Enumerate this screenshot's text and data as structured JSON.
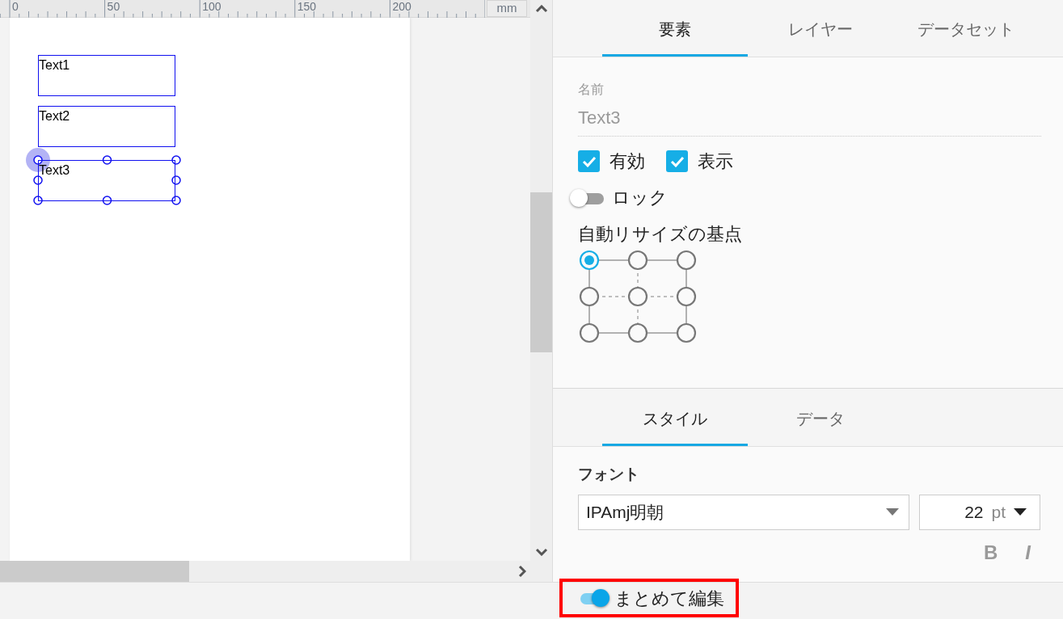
{
  "ruler": {
    "labels": [
      "0",
      "50",
      "100",
      "150",
      "200"
    ],
    "unit": "mm"
  },
  "canvas": {
    "elements": [
      {
        "label": "Text1",
        "selected": false
      },
      {
        "label": "Text2",
        "selected": false
      },
      {
        "label": "Text3",
        "selected": true
      }
    ]
  },
  "tabs": [
    {
      "label": "要素",
      "selected": true
    },
    {
      "label": "レイヤー",
      "selected": false
    },
    {
      "label": "データセット",
      "selected": false
    }
  ],
  "element": {
    "name_label": "名前",
    "name_value": "Text3",
    "checkboxes": [
      {
        "label": "有効",
        "checked": true
      },
      {
        "label": "表示",
        "checked": true
      }
    ],
    "lock": {
      "label": "ロック",
      "on": false
    },
    "anchor": {
      "label": "自動リサイズの基点",
      "points": [
        {
          "selected": true
        },
        {
          "selected": false
        },
        {
          "selected": false
        },
        {
          "selected": false
        },
        {
          "selected": false
        },
        {
          "selected": false
        },
        {
          "selected": false
        },
        {
          "selected": false
        },
        {
          "selected": false
        }
      ]
    }
  },
  "style_tabs": [
    {
      "label": "スタイル",
      "selected": true
    },
    {
      "label": "データ",
      "selected": false
    }
  ],
  "font": {
    "label": "フォント",
    "family": "IPAmj明朝",
    "size": "22",
    "unit": "pt"
  },
  "format_buttons": [
    {
      "label": "B",
      "kind": "bold",
      "disabled": true
    },
    {
      "label": "I",
      "kind": "italic",
      "disabled": true
    }
  ],
  "batch_edit": {
    "label": "まとめて編集",
    "on": true,
    "highlighted": true
  }
}
